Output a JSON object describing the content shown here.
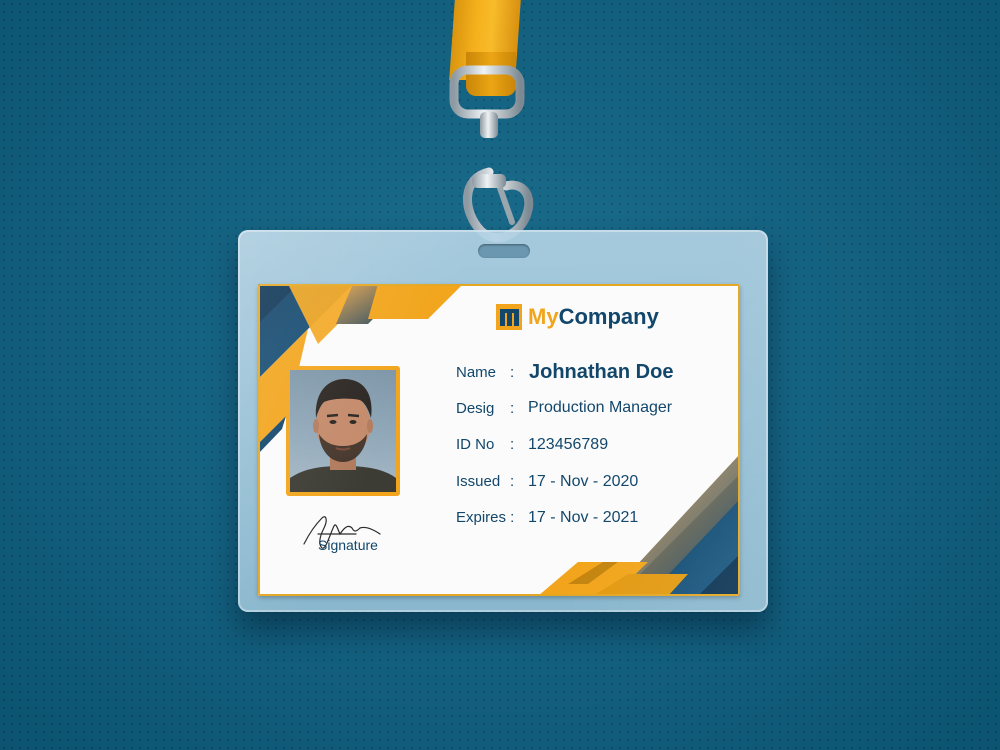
{
  "company": {
    "prefix": "My",
    "suffix": "Company"
  },
  "employee": {
    "name_label": "Name",
    "name": "Johnathan Doe",
    "desig_label": "Desig",
    "designation": "Production Manager",
    "id_label": "ID No",
    "id_number": "123456789",
    "issued_label": "Issued",
    "issued": "17 - Nov - 2020",
    "expires_label": "Expires :",
    "expires": "17 - Nov - 2021",
    "colon": ":"
  },
  "signature_label": "Signature",
  "colors": {
    "background": "#0e6689",
    "accent": "#f2a51c",
    "navy": "#12476b",
    "lanyard": "#f5b11c"
  },
  "icons": {
    "logo": "company-logo-icon",
    "clip": "lanyard-clip-icon"
  }
}
